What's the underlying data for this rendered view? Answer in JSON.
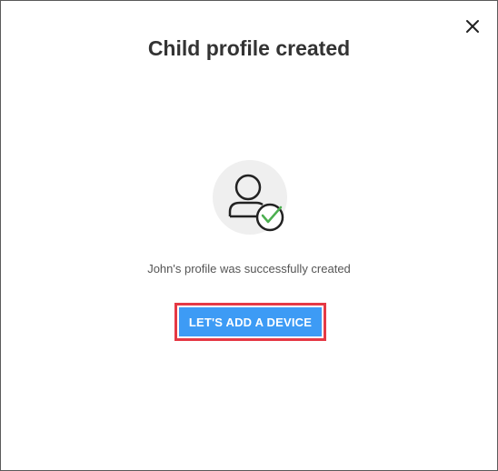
{
  "dialog": {
    "title": "Child profile created",
    "message": "John's profile was successfully created",
    "primary_button_label": "LET'S ADD A DEVICE",
    "close_icon": "close-icon",
    "illustration_icon": "user-check-icon"
  },
  "colors": {
    "button_background": "#3d9bf5",
    "highlight_border": "#e53945",
    "check_color": "#4caf50",
    "avatar_background": "#efefef"
  }
}
